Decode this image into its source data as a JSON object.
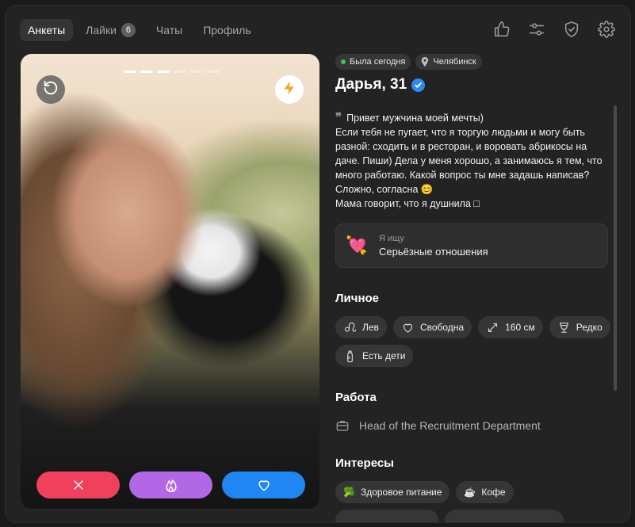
{
  "nav": {
    "tabs": [
      {
        "label": "Анкеты",
        "active": true
      },
      {
        "label": "Лайки",
        "badge": "6"
      },
      {
        "label": "Чаты"
      },
      {
        "label": "Профиль"
      }
    ]
  },
  "header_icons": [
    "thumbs-up-icon",
    "filters-icon",
    "shield-check-icon",
    "settings-icon"
  ],
  "photo": {
    "slides_total": 6,
    "slide_current": 3,
    "buttons": [
      "undo-icon",
      "boost-lightning-icon"
    ],
    "actions": [
      "dislike-x-icon",
      "superlike-flame-icon",
      "like-heart-icon"
    ]
  },
  "profile": {
    "status": "Была сегодня",
    "city": "Челябинск",
    "name": "Дарья, 31",
    "verified": true,
    "bio": "Привет мужчина моей мечты)\nЕсли тебя не пугает, что я торгую людьми и могу быть разной: сходить и в ресторан, и воровать абрикосы на даче. Пиши) Дела у меня хорошо, а занимаюсь я тем, что много работаю. Какой вопрос ты мне задашь написав? Сложно, согласна 😊\nМама говорит, что я душнила □",
    "looking_for": {
      "label": "Я ищу",
      "value": "Серьёзные отношения",
      "emoji": "💘"
    }
  },
  "sections": {
    "personal_title": "Личное",
    "personal": [
      {
        "icon": "zodiac-leo-icon",
        "label": "Лев"
      },
      {
        "icon": "heart-outline-icon",
        "label": "Свободна"
      },
      {
        "icon": "height-arrows-icon",
        "label": "160 см"
      },
      {
        "icon": "wine-glass-icon",
        "label": "Редко"
      },
      {
        "icon": "baby-bottle-icon",
        "label": "Есть дети"
      }
    ],
    "work_title": "Работа",
    "work": "Head of the Recruitment Department",
    "interests_title": "Интересы",
    "interests": [
      {
        "emoji": "🥦",
        "label": "Здоровое питание"
      },
      {
        "emoji": "☕",
        "label": "Кофе"
      }
    ]
  },
  "colors": {
    "dislike": "#f0405b",
    "superlike": "#b268e6",
    "like": "#1f86f2",
    "verified": "#2b8bf5",
    "online": "#3dc25a"
  }
}
